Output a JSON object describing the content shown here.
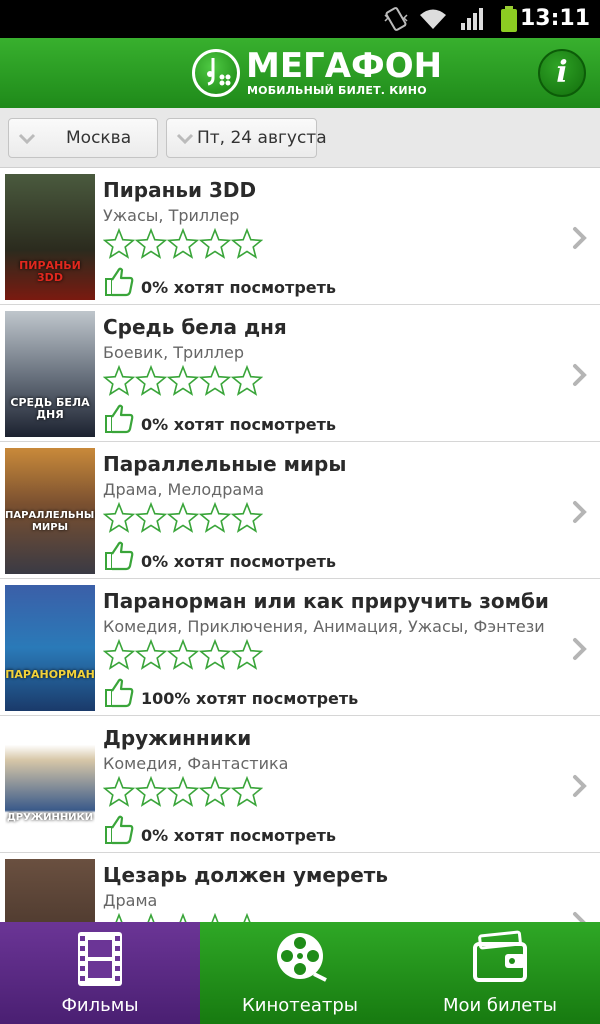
{
  "status_bar": {
    "time": "13:11"
  },
  "header": {
    "brand": "МегаФон",
    "subtitle": "МОБИЛЬНЫЙ БИЛЕТ. КИНО",
    "info_label": "i"
  },
  "filters": {
    "city": "Москва",
    "date": "Пт, 24 августа"
  },
  "movies": [
    {
      "title": "Пираньи 3DD",
      "genre": "Ужасы, Триллер",
      "want": "0% хотят посмотреть",
      "poster_text": "ПИРАНЬИ 3DD",
      "rating": 0
    },
    {
      "title": "Средь бела дня",
      "genre": "Боевик, Триллер",
      "want": "0% хотят посмотреть",
      "poster_text": "СРЕДЬ БЕЛА ДНЯ",
      "rating": 0
    },
    {
      "title": "Параллельные миры",
      "genre": "Драма, Мелодрама",
      "want": "0% хотят посмотреть",
      "poster_text": "ПАРАЛЛЕЛЬНЫЕ МИРЫ",
      "rating": 0
    },
    {
      "title": "Паранорман или как приручить зомби",
      "genre": "Комедия, Приключения, Анимация, Ужасы, Фэнтези",
      "want": "100% хотят посмотреть",
      "poster_text": "ПАРАНОРМАН",
      "rating": 0
    },
    {
      "title": "Дружинники",
      "genre": "Комедия, Фантастика",
      "want": "0% хотят посмотреть",
      "poster_text": "ДРУЖИННИКИ",
      "rating": 0
    },
    {
      "title": "Цезарь должен умереть",
      "genre": "Драма",
      "want": "",
      "poster_text": "",
      "rating": 0
    }
  ],
  "tabs": [
    {
      "label": "Фильмы",
      "icon": "film-strip-icon",
      "active": true
    },
    {
      "label": "Кинотеатры",
      "icon": "film-reel-icon",
      "active": false
    },
    {
      "label": "Мои билеты",
      "icon": "wallet-ticket-icon",
      "active": false
    }
  ],
  "colors": {
    "brand_green": "#2a9d22",
    "active_tab": "#5b2a86",
    "star_outline": "#3aa53a"
  }
}
